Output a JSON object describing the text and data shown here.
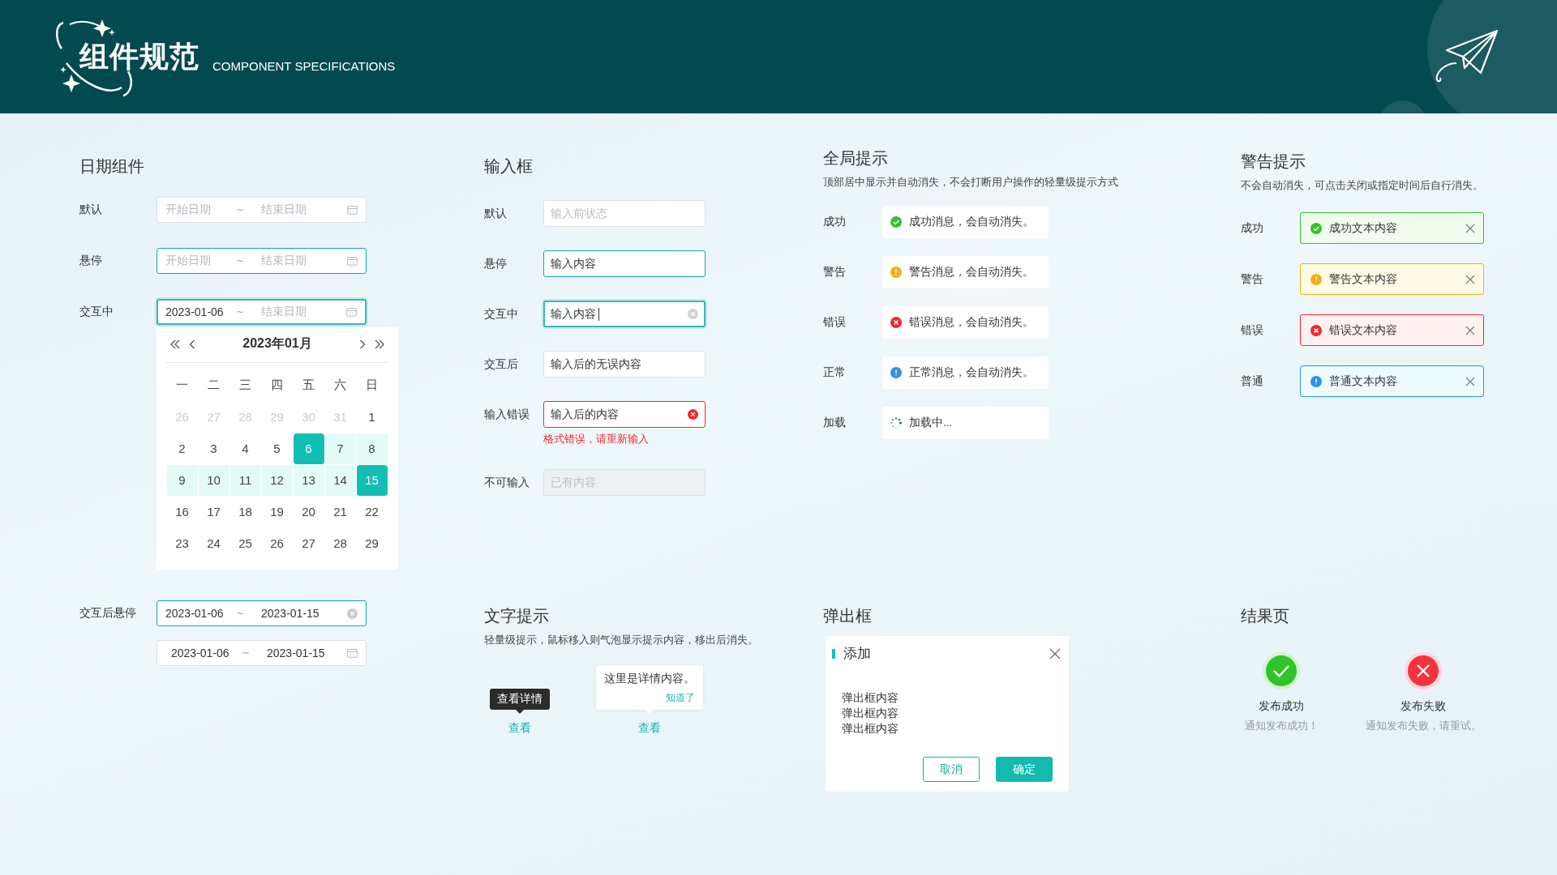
{
  "header": {
    "title": "组件规范",
    "subtitle": "COMPONENT SPECIFICATIONS"
  },
  "date_section": {
    "title": "日期组件",
    "rows": [
      {
        "label": "默认",
        "kind": "calendar",
        "hovered": false,
        "focused": false,
        "start": {
          "placeholder": "开始日期"
        },
        "separator": "~",
        "end": {
          "placeholder": "结束日期"
        }
      },
      {
        "label": "悬停",
        "kind": "calendar",
        "hovered": true,
        "focused": false,
        "start": {
          "placeholder": "开始日期"
        },
        "separator": "~",
        "end": {
          "placeholder": "结束日期"
        }
      },
      {
        "label": "交互中",
        "kind": "calendar",
        "hovered": true,
        "focused": true,
        "start": {
          "value": "2023-01-06"
        },
        "separator": "~",
        "end": {
          "placeholder": "结束日期"
        }
      },
      {
        "label": "交互后悬停",
        "kind": "clearable",
        "hovered": true,
        "focused": false,
        "start": {
          "value": "2023-01-06"
        },
        "separator": "~",
        "end": {
          "value": "2023-01-15"
        }
      },
      {
        "kind": "calendar",
        "hovered": false,
        "focused": false,
        "start": {
          "value": "2023-01-06"
        },
        "separator": "~",
        "end": {
          "value": "2023-01-15"
        }
      }
    ],
    "calendar": {
      "title": "2023年01月",
      "weekdays": [
        "一",
        "二",
        "三",
        "四",
        "五",
        "六",
        "日"
      ],
      "days": [
        {
          "text": "26",
          "kind": "other",
          "in_range": false,
          "selected": false
        },
        {
          "text": "27",
          "kind": "other",
          "in_range": false,
          "selected": false
        },
        {
          "text": "28",
          "kind": "other",
          "in_range": false,
          "selected": false
        },
        {
          "text": "29",
          "kind": "other",
          "in_range": false,
          "selected": false
        },
        {
          "text": "30",
          "kind": "other",
          "in_range": false,
          "selected": false
        },
        {
          "text": "31",
          "kind": "other",
          "in_range": false,
          "selected": false
        },
        {
          "text": "1",
          "kind": "current",
          "in_range": false,
          "selected": false
        },
        {
          "text": "2",
          "kind": "current",
          "in_range": false,
          "selected": false
        },
        {
          "text": "3",
          "kind": "current",
          "in_range": false,
          "selected": false
        },
        {
          "text": "4",
          "kind": "current",
          "in_range": false,
          "selected": false
        },
        {
          "text": "5",
          "kind": "current",
          "in_range": false,
          "selected": false
        },
        {
          "text": "6",
          "kind": "current",
          "in_range": true,
          "selected": true
        },
        {
          "text": "7",
          "kind": "current",
          "in_range": true,
          "selected": false
        },
        {
          "text": "8",
          "kind": "current",
          "in_range": true,
          "selected": false
        },
        {
          "text": "9",
          "kind": "current",
          "in_range": true,
          "selected": false
        },
        {
          "text": "10",
          "kind": "current",
          "in_range": true,
          "selected": false
        },
        {
          "text": "11",
          "kind": "current",
          "in_range": true,
          "selected": false
        },
        {
          "text": "12",
          "kind": "current",
          "in_range": true,
          "selected": false
        },
        {
          "text": "13",
          "kind": "current",
          "in_range": true,
          "selected": false
        },
        {
          "text": "14",
          "kind": "current",
          "in_range": true,
          "selected": false
        },
        {
          "text": "15",
          "kind": "current",
          "in_range": true,
          "selected": true
        },
        {
          "text": "16",
          "kind": "current",
          "in_range": false,
          "selected": false
        },
        {
          "text": "17",
          "kind": "current",
          "in_range": false,
          "selected": false
        },
        {
          "text": "18",
          "kind": "current",
          "in_range": false,
          "selected": false
        },
        {
          "text": "19",
          "kind": "current",
          "in_range": false,
          "selected": false
        },
        {
          "text": "20",
          "kind": "current",
          "in_range": false,
          "selected": false
        },
        {
          "text": "21",
          "kind": "current",
          "in_range": false,
          "selected": false
        },
        {
          "text": "22",
          "kind": "current",
          "in_range": false,
          "selected": false
        },
        {
          "text": "23",
          "kind": "current",
          "in_range": false,
          "selected": false
        },
        {
          "text": "24",
          "kind": "current",
          "in_range": false,
          "selected": false
        },
        {
          "text": "25",
          "kind": "current",
          "in_range": false,
          "selected": false
        },
        {
          "text": "26",
          "kind": "current",
          "in_range": false,
          "selected": false
        },
        {
          "text": "27",
          "kind": "current",
          "in_range": false,
          "selected": false
        },
        {
          "text": "28",
          "kind": "current",
          "in_range": false,
          "selected": false
        },
        {
          "text": "29",
          "kind": "current",
          "in_range": false,
          "selected": false
        }
      ]
    }
  },
  "input_section": {
    "title": "输入框",
    "rows": [
      {
        "label": "默认",
        "hovered": false,
        "focused": false,
        "error": false,
        "disabled": false,
        "placeholder": "输入前状态"
      },
      {
        "label": "悬停",
        "hovered": true,
        "focused": false,
        "error": false,
        "disabled": false,
        "value": "输入内容"
      },
      {
        "label": "交互中",
        "hovered": false,
        "focused": true,
        "error": false,
        "disabled": false,
        "value": "输入内容"
      },
      {
        "label": "交互后",
        "hovered": false,
        "focused": false,
        "error": false,
        "disabled": false,
        "value": "输入后的无误内容"
      },
      {
        "label": "输入错误",
        "hovered": false,
        "focused": false,
        "error": true,
        "disabled": false,
        "value": "输入后的内容",
        "error_message": "格式错误，请重新输入"
      },
      {
        "label": "不可输入",
        "hovered": false,
        "focused": false,
        "error": false,
        "disabled": true,
        "placeholder": "已有内容"
      }
    ]
  },
  "message_section": {
    "title": "全局提示",
    "description": "顶部居中显示并自动消失，不会打断用户操作的轻量级提示方式",
    "rows": [
      {
        "label": "成功",
        "kind": "success",
        "text": "成功消息，会自动消失。"
      },
      {
        "label": "警告",
        "kind": "warning",
        "text": "警告消息，会自动消失。"
      },
      {
        "label": "错误",
        "kind": "error",
        "text": "错误消息，会自动消失。"
      },
      {
        "label": "正常",
        "kind": "info",
        "text": "正常消息，会自动消失。"
      },
      {
        "label": "加载",
        "kind": "loading",
        "text": "加载中..."
      }
    ]
  },
  "alert_section": {
    "title": "警告提示",
    "description": "不会自动消失，可点击关闭或指定时间后自行消失。",
    "rows": [
      {
        "label": "成功",
        "kind": "success",
        "text": "成功文本内容"
      },
      {
        "label": "警告",
        "kind": "warning",
        "text": "警告文本内容"
      },
      {
        "label": "错误",
        "kind": "error",
        "text": "错误文本内容"
      },
      {
        "label": "普通",
        "kind": "info",
        "text": "普通文本内容"
      }
    ]
  },
  "tooltip_section": {
    "title": "文字提示",
    "description": "轻量级提示，鼠标移入则气泡显示提示内容，移出后消失。",
    "examples": [
      {
        "kind": "tooltip",
        "tip": "查看详情",
        "link": "查看"
      },
      {
        "kind": "popover",
        "tip": "这里是详情内容。",
        "action": "知道了",
        "link": "查看"
      }
    ]
  },
  "dialog_section": {
    "title": "弹出框",
    "dialog": {
      "title": "添加",
      "lines": [
        "弹出框内容",
        "弹出框内容",
        "弹出框内容"
      ],
      "buttons": [
        {
          "label": "取消",
          "kind": "secondary"
        },
        {
          "label": "确定",
          "kind": "primary"
        }
      ]
    }
  },
  "result_section": {
    "title": "结果页",
    "items": [
      {
        "kind": "success",
        "title": "发布成功",
        "message": "通知发布成功！"
      },
      {
        "kind": "error",
        "title": "发布失败",
        "message": "通知发布失败，请重试。"
      }
    ]
  }
}
